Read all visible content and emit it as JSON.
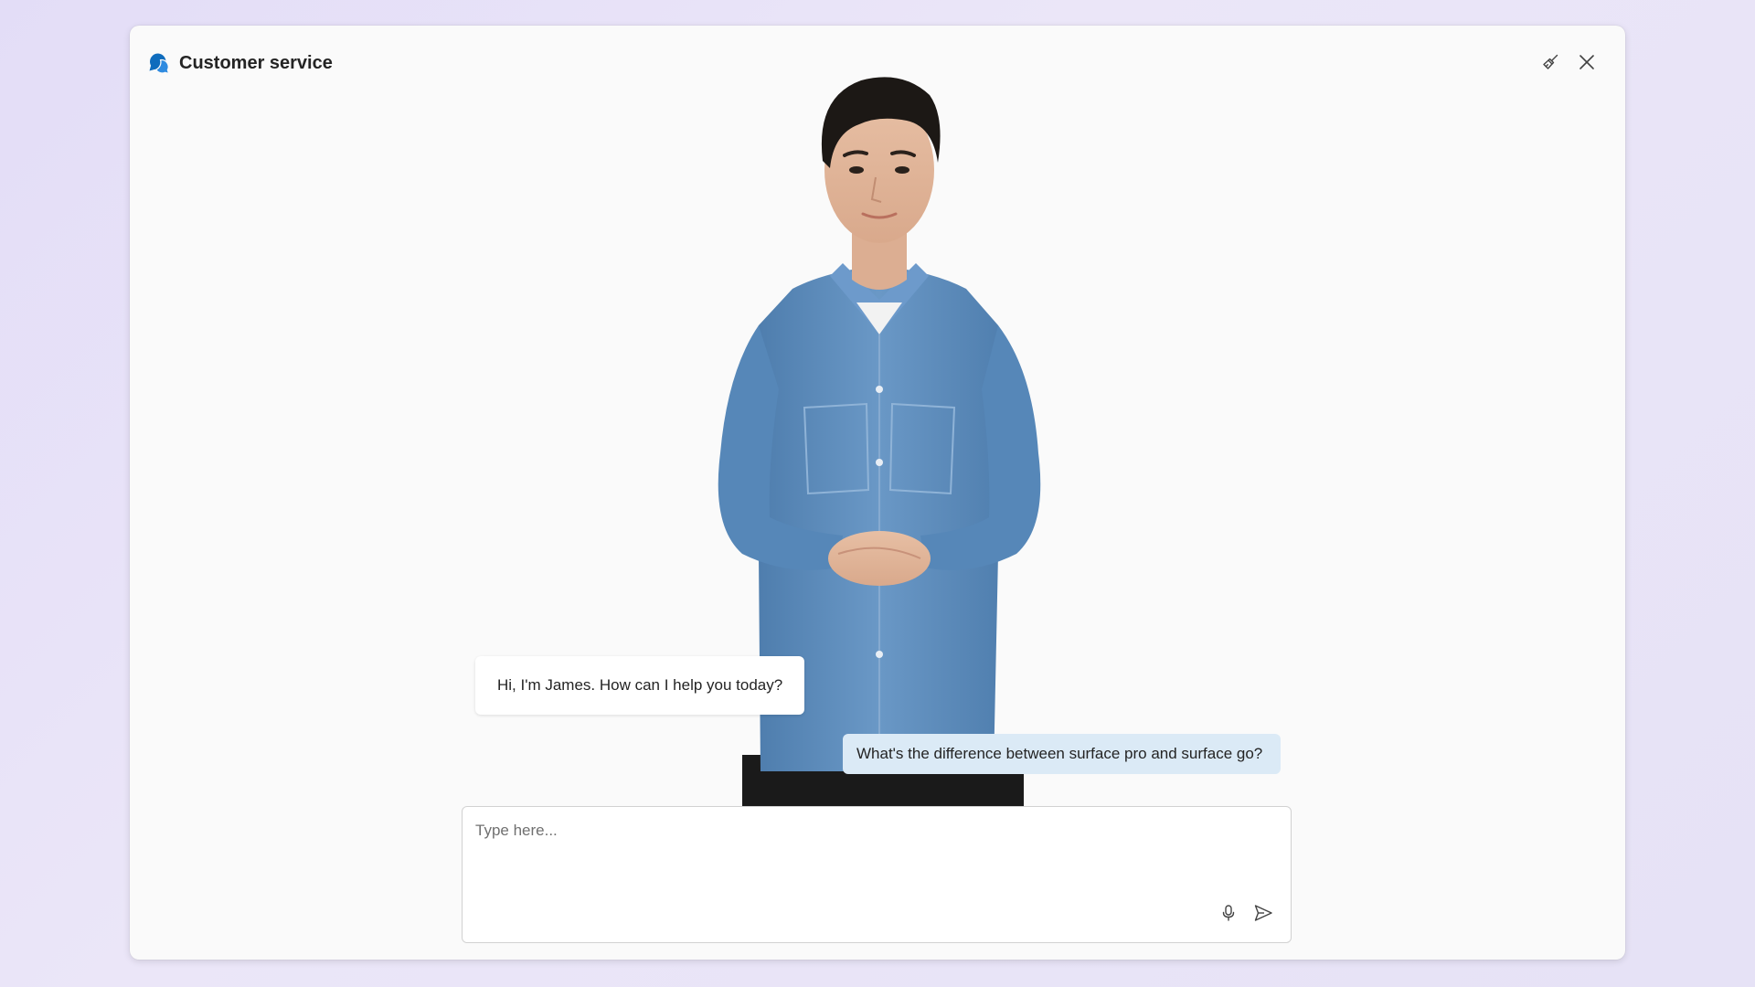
{
  "window": {
    "title": "Customer service",
    "icon": "chat-bubbles-icon",
    "accent_color": "#0f6cbd"
  },
  "toolbar": {
    "clear_icon": "broom-icon",
    "close_icon": "close-icon"
  },
  "conversation": {
    "messages": [
      {
        "role": "assistant",
        "text": "Hi, I'm James. How can I help you today?"
      },
      {
        "role": "user",
        "text": "What's the difference between surface pro and surface go?"
      }
    ]
  },
  "composer": {
    "value": "",
    "placeholder": "Type here...",
    "mic_icon": "microphone-icon",
    "send_icon": "send-icon"
  }
}
